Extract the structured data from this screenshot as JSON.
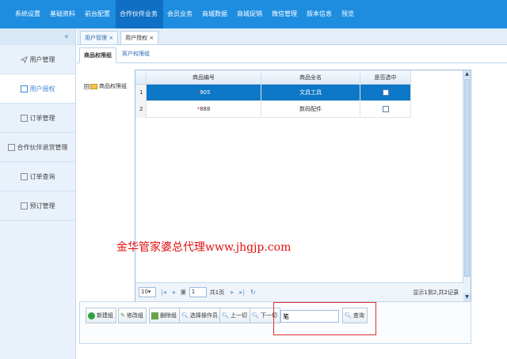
{
  "topnav": {
    "items": [
      "系统设置",
      "基础资料",
      "前台配置",
      "合作伙伴业务",
      "会员业务",
      "商城数据",
      "商城促销",
      "微信管理",
      "版本信息",
      "预览"
    ],
    "active_index": 3
  },
  "sidebar": {
    "collapse_glyph": "«",
    "items": [
      {
        "label": "用户管理",
        "icon": "send-icon"
      },
      {
        "label": "用户授权",
        "icon": "document-icon"
      },
      {
        "label": "订单管理",
        "icon": "document-icon"
      },
      {
        "label": "合作伙伴退货管理",
        "icon": "document-icon"
      },
      {
        "label": "订单查询",
        "icon": "document-icon"
      },
      {
        "label": "预订管理",
        "icon": "document-icon"
      }
    ],
    "active_index": 1
  },
  "page_tabs": [
    {
      "label": "用户管理 ×"
    },
    {
      "label": "用户授权 ×"
    }
  ],
  "sub_tabs": [
    {
      "label": "商品权限组"
    },
    {
      "label": "客户权限组"
    }
  ],
  "tree": {
    "expander": "⊞",
    "label": "商品权限组"
  },
  "grid": {
    "columns": [
      "商品编号",
      "商品全名",
      "是否选中"
    ],
    "rows": [
      {
        "num": "1",
        "code": "905",
        "name": "文具工具",
        "selected": true
      },
      {
        "num": "2",
        "code": "888",
        "name": "数码配件",
        "selected": false
      }
    ]
  },
  "pager": {
    "page_size": "10",
    "page_prefix": "第",
    "page_value": "1",
    "page_suffix": "共1页",
    "info": "显示1到2,共2记录"
  },
  "toolbar": {
    "buttons": [
      "新建组",
      "修改组",
      "删除组",
      "选择操作员",
      "上一切",
      "下一切"
    ],
    "search_value": "笔",
    "search_button": "查询"
  },
  "watermark": "金华管家婆总代理www.jhgjp.com",
  "colors": {
    "nav": "#1e8de0",
    "selected_row": "#0d77c8",
    "highlight_box": "#e03030"
  }
}
